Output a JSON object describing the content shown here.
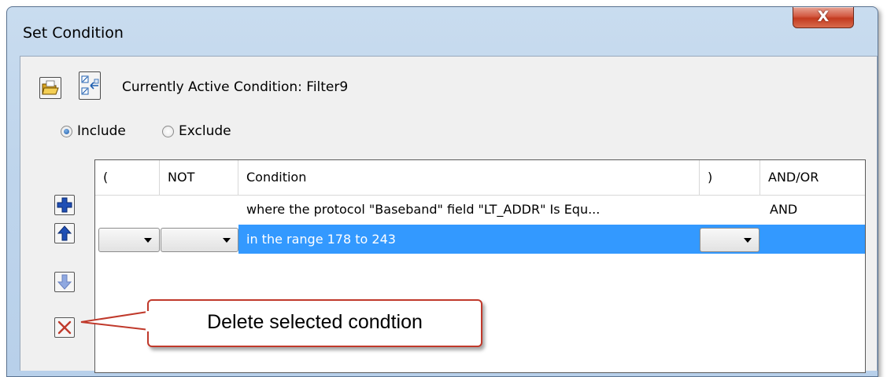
{
  "window": {
    "title": "Set Condition",
    "close_glyph": "X"
  },
  "toolbar": {
    "open_icon": "folder-open-icon",
    "apply_icon": "apply-condition-icon",
    "active_label": "Currently Active Condition:  Filter9"
  },
  "mode": {
    "include_label": "Include",
    "exclude_label": "Exclude",
    "selected": "Include"
  },
  "side_buttons": [
    {
      "name": "add-condition-button",
      "icon": "plus-icon"
    },
    {
      "name": "move-up-button",
      "icon": "arrow-up-icon"
    },
    {
      "name": "move-down-button",
      "icon": "arrow-down-icon"
    },
    {
      "name": "delete-condition-button",
      "icon": "x-icon"
    }
  ],
  "grid": {
    "columns": [
      "(",
      "NOT",
      "Condition",
      ")",
      "AND/OR"
    ],
    "rows": [
      {
        "open_paren": "",
        "not": "",
        "condition": "where the protocol \"Baseband\" field \"LT_ADDR\" Is Equ...",
        "close_paren": "",
        "and_or": "AND"
      },
      {
        "open_paren": "",
        "not": "",
        "condition": "in the range 178 to 243",
        "close_paren": "",
        "and_or": "",
        "selected": true
      }
    ]
  },
  "callout": {
    "text": "Delete selected condtion"
  },
  "colors": {
    "selection": "#3399ff",
    "callout_border": "#c0392b",
    "close_button": "#c9462b"
  }
}
